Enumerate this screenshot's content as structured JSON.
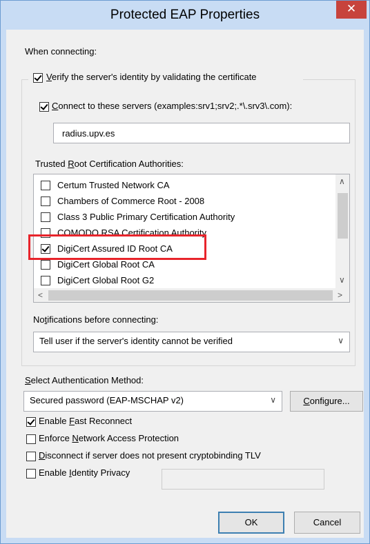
{
  "title": "Protected EAP Properties",
  "close_glyph": "✕",
  "when_connecting": "When connecting:",
  "verify": {
    "checked": true,
    "label_pre": "",
    "label_ul": "V",
    "label_post": "erify the server's identity by validating the certificate"
  },
  "connect": {
    "checked": true,
    "label_ul": "C",
    "label_post": "onnect to these servers (examples:srv1;srv2;.*\\.srv3\\.com):",
    "value": "radius.upv.es"
  },
  "trusted_root": {
    "label_pre": "Trusted ",
    "label_ul": "R",
    "label_post": "oot Certification Authorities:",
    "items": [
      {
        "label": "Certum Trusted Network CA",
        "checked": false
      },
      {
        "label": "Chambers of Commerce Root - 2008",
        "checked": false
      },
      {
        "label": "Class 3 Public Primary Certification Authority",
        "checked": false
      },
      {
        "label": "COMODO RSA Certification Authority",
        "checked": false
      },
      {
        "label": "DigiCert Assured ID Root CA",
        "checked": true
      },
      {
        "label": "DigiCert Global Root CA",
        "checked": false
      },
      {
        "label": "DigiCert Global Root G2",
        "checked": false
      }
    ]
  },
  "notifications": {
    "label_pre": "No",
    "label_ul": "t",
    "label_post": "ifications before connecting:",
    "value": "Tell user if the server's identity cannot be verified"
  },
  "auth_method": {
    "label_ul": "S",
    "label_post": "elect Authentication Method:",
    "value": "Secured password (EAP-MSCHAP v2)",
    "configure_ul": "C",
    "configure_post": "onfigure..."
  },
  "options": {
    "fast_reconnect": {
      "checked": true,
      "pre": "Enable ",
      "ul": "F",
      "post": "ast Reconnect"
    },
    "nap": {
      "checked": false,
      "pre": "Enforce ",
      "ul": "N",
      "post": "etwork Access Protection"
    },
    "disconnect": {
      "checked": false,
      "pre": "",
      "ul": "D",
      "post": "isconnect if server does not present cryptobinding TLV"
    },
    "identity_privacy": {
      "checked": false,
      "pre": "Enable ",
      "ul": "I",
      "post": "dentity Privacy"
    }
  },
  "buttons": {
    "ok": "OK",
    "cancel": "Cancel"
  },
  "glyphs": {
    "chevron_down": "∨",
    "chevron_up": "∧",
    "chevron_left": "<",
    "chevron_right": ">"
  },
  "colors": {
    "title_bar": "#c8dcf4",
    "close_button": "#c7433c",
    "highlight_box": "#e8242b"
  }
}
